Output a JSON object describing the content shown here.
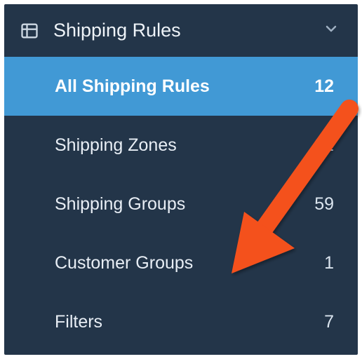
{
  "section": {
    "title": "Shipping Rules"
  },
  "nav": {
    "items": [
      {
        "label": "All Shipping Rules",
        "count": "12",
        "active": true
      },
      {
        "label": "Shipping Zones",
        "count": "22",
        "active": false
      },
      {
        "label": "Shipping Groups",
        "count": "59",
        "active": false
      },
      {
        "label": "Customer Groups",
        "count": "1",
        "active": false
      },
      {
        "label": "Filters",
        "count": "7",
        "active": false
      }
    ]
  },
  "annotation": {
    "arrow_color": "#f4511e",
    "target": "Customer Groups"
  }
}
